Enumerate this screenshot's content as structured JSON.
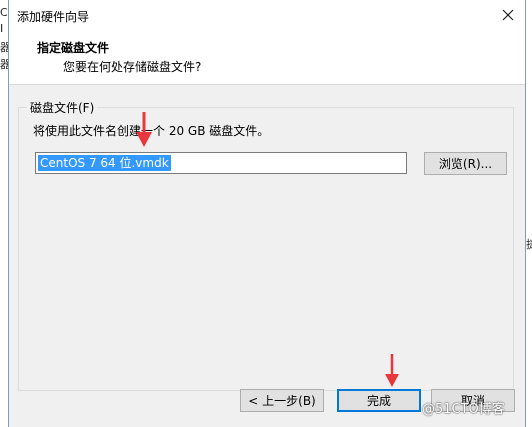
{
  "background": {
    "left_chars": [
      "C",
      "I",
      "器",
      "器"
    ],
    "right_char": "捷"
  },
  "dialog": {
    "title": "添加硬件向导",
    "header_title": "指定磁盘文件",
    "header_subtitle": "您要在何处存储磁盘文件?",
    "group_label": "磁盘文件(F)",
    "description": "将使用此文件名创建一个 20 GB 磁盘文件。",
    "file_value": "CentOS 7 64 位.vmdk",
    "browse_label": "浏览(R)...",
    "back_label": "< 上一步(B)",
    "finish_label": "完成",
    "cancel_label": "取消"
  },
  "watermark": "@51CTO博客",
  "colors": {
    "annotation_arrow": "#e8383d",
    "selection": "#3399ff",
    "default_button_border": "#0078d7"
  }
}
